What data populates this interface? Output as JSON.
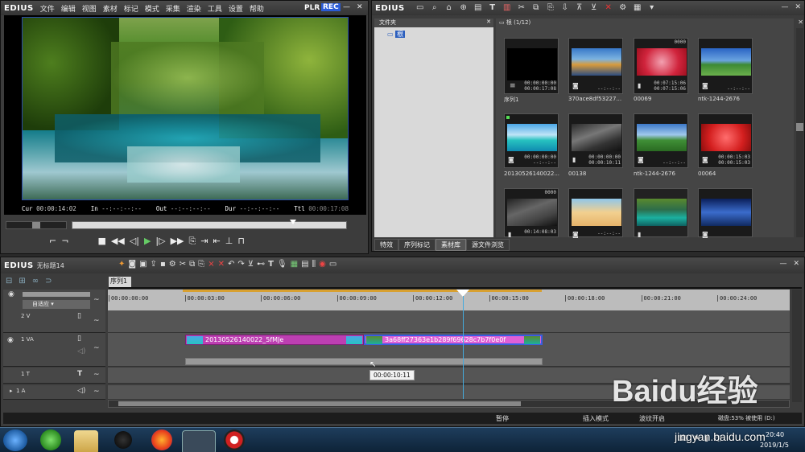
{
  "player": {
    "logo": "EDIUS",
    "menu": [
      "文件",
      "编辑",
      "视图",
      "素材",
      "标记",
      "模式",
      "采集",
      "渲染",
      "工具",
      "设置",
      "帮助"
    ],
    "plr": "PLR",
    "rec": "REC",
    "cur_label": "Cur",
    "cur_value": "00:00:14:02",
    "in_label": "In",
    "in_value": "--:--:--:--",
    "out_label": "Out",
    "out_value": "--:--:--:--",
    "dur_label": "Dur",
    "dur_value": "--:--:--:--",
    "ttl_label": "Ttl",
    "ttl_value": "00:00:17:08"
  },
  "bin": {
    "logo": "EDIUS",
    "folder_header": "文件夹",
    "root_label": "根",
    "path_label": "根 (1/12)",
    "tabs": [
      "特效",
      "序列标记",
      "素材库",
      "源文件浏览"
    ],
    "clips": [
      {
        "name": "序列1",
        "tc1": "00:00:00:00",
        "tc2": "00:00:17:08",
        "badge": ""
      },
      {
        "name": "370ace8df53227...",
        "tc1": "",
        "tc2": "--:--:--",
        "badge": ""
      },
      {
        "name": "00069",
        "tc1": "00:07:15:06",
        "tc2": "00:07:15:06",
        "badge": "0000"
      },
      {
        "name": "ntk-1244-2676",
        "tc1": "",
        "tc2": "--:--:--",
        "badge": ""
      },
      {
        "name": "20130526140022...",
        "tc1": "00:00:00:00",
        "tc2": "--:--:--",
        "badge": ""
      },
      {
        "name": "00138",
        "tc1": "00:00:00:00",
        "tc2": "00:00:10:11",
        "badge": ""
      },
      {
        "name": "ntk-1244-2676",
        "tc1": "",
        "tc2": "--:--:--",
        "badge": ""
      },
      {
        "name": "00064",
        "tc1": "00:00:15:03",
        "tc2": "00:00:15:03",
        "badge": ""
      },
      {
        "name": "",
        "tc1": "00:14:08:03",
        "tc2": "",
        "badge": "0000"
      },
      {
        "name": "",
        "tc1": "",
        "tc2": "--:--:--",
        "badge": ""
      },
      {
        "name": "",
        "tc1": "",
        "tc2": "",
        "badge": ""
      },
      {
        "name": "",
        "tc1": "",
        "tc2": "",
        "badge": ""
      }
    ]
  },
  "timeline": {
    "logo": "EDIUS",
    "project_name": "无标题14",
    "sequence_tab": "序列1",
    "mode_label": "自适应",
    "ruler": [
      "00:00:00:00",
      "00:00:03:00",
      "00:00:06:00",
      "00:00:09:00",
      "00:00:12:00",
      "00:00:15:00",
      "00:00:18:00",
      "00:00:21:00",
      "00:00:24:00"
    ],
    "tracks": [
      "2 V",
      "1 VA",
      "1 T",
      "1 A"
    ],
    "clip1": "20130526140022_5fMJe",
    "clip2": "3a68ff27363e1b289f69628c7b7f0e0f",
    "tooltip": "00:00:10:11",
    "status_pause": "暂停",
    "status_insert": "插入模式",
    "status_ripple": "波纹开启",
    "status_disk": "磁盘:53% 被使用 (D:)"
  },
  "taskbar": {
    "time": "20:40",
    "date": "2019/1/5"
  },
  "watermark": {
    "brand": "Baidu经验",
    "url": "jingyan.baidu.com"
  }
}
